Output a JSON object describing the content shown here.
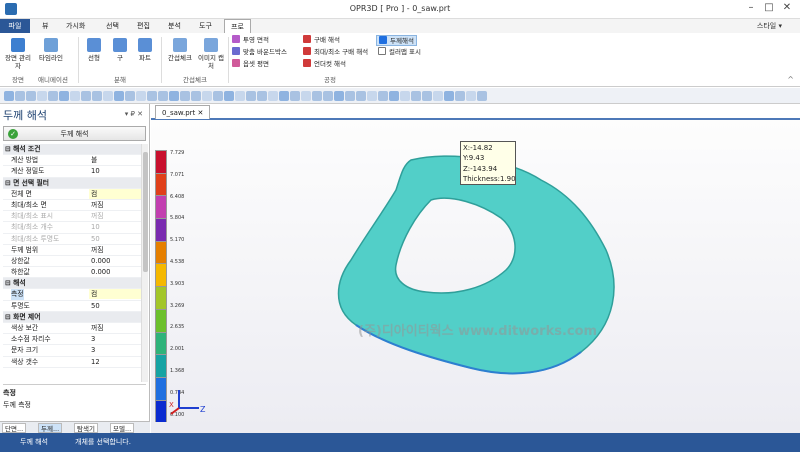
{
  "window": {
    "title": "OPR3D [ Pro ] - 0_saw.prt",
    "style_label": "스타일"
  },
  "menu": {
    "items": [
      "파일",
      "뷰",
      "가시화",
      "선택",
      "편집",
      "분석",
      "도구",
      "프로"
    ],
    "active_index": 7
  },
  "ribbon": {
    "btn_align": "장면 관리자",
    "btn_timeline": "타임라인",
    "grp_scene": "장면",
    "grp_anim": "애니메이션",
    "btn_line": "선형",
    "btn_sphere": "구",
    "btn_part": "파트",
    "grp_dist": "분해",
    "btn_gap": "간섭체크",
    "btn_image": "이미지 캡처",
    "grp_check": "간섭체크",
    "small": [
      "투영 면적",
      "맞춤 바운드박스",
      "옵셋 평면",
      "구배 해석",
      "최대/최소 구배 해석",
      "언더컷 해석",
      "두께해석",
      "컬러맵 표시"
    ],
    "grp_process": "공정"
  },
  "panel": {
    "title": "두께 해석",
    "controls": "▾ ₽ ✕",
    "calc_button": "두께 해석",
    "rows": [
      {
        "type": "cat",
        "k": "해석 조건"
      },
      {
        "k": "계산 방법",
        "v": "볼"
      },
      {
        "k": "계산 정밀도",
        "v": "10"
      },
      {
        "type": "cat",
        "k": "면 선택 필터"
      },
      {
        "k": "전체 면",
        "v": "컴",
        "hl": true
      },
      {
        "k": "최대/최소 면",
        "v": "꺼짐"
      },
      {
        "k": "최대/최소 표시",
        "v": "꺼짐",
        "dis": true
      },
      {
        "k": "최대/최소 개수",
        "v": "10",
        "dis": true
      },
      {
        "k": "최대/최소 투명도",
        "v": "50",
        "dis": true
      },
      {
        "k": "두께 범위",
        "v": "꺼짐"
      },
      {
        "k": "상한값",
        "v": "0.000"
      },
      {
        "k": "하한값",
        "v": "0.000"
      },
      {
        "type": "cat",
        "k": "해석"
      },
      {
        "k": "측정",
        "v": "컴",
        "hl": true,
        "sel": true
      },
      {
        "k": "투명도",
        "v": "50"
      },
      {
        "type": "cat",
        "k": "화면 제어"
      },
      {
        "k": "색상 보간",
        "v": "꺼짐"
      },
      {
        "k": "소수점 자리수",
        "v": "3"
      },
      {
        "k": "문자 크기",
        "v": "3"
      },
      {
        "k": "색상 갯수",
        "v": "12"
      }
    ],
    "desc_title": "측정",
    "desc_text": "두께 측정",
    "bottom_tabs": [
      "단면...",
      "두께...",
      "탐색기",
      "모델..."
    ]
  },
  "doc_tab": "0_saw.prt",
  "legend": {
    "colors": [
      "#c8102e",
      "#e0401a",
      "#c23fb0",
      "#7a2bb0",
      "#e57f00",
      "#f5b800",
      "#a3c62a",
      "#6cc02c",
      "#2fb37a",
      "#16a3a3",
      "#1f6fe0",
      "#0b2bd0"
    ],
    "values": [
      "7.729",
      "7.071",
      "6.408",
      "5.804",
      "5.170",
      "4.538",
      "3.903",
      "3.269",
      "2.635",
      "2.001",
      "1.368",
      "0.734",
      "0.100"
    ]
  },
  "tooltip": {
    "x": "X:-14.82",
    "y": "Y:9.43",
    "z": "Z:-143.94",
    "t": "Thickness:1.90"
  },
  "watermark": "(주)디아이티웍스 www.ditworks.com",
  "status": {
    "left": "두께 해석",
    "right": "개체를 선택합니다."
  }
}
